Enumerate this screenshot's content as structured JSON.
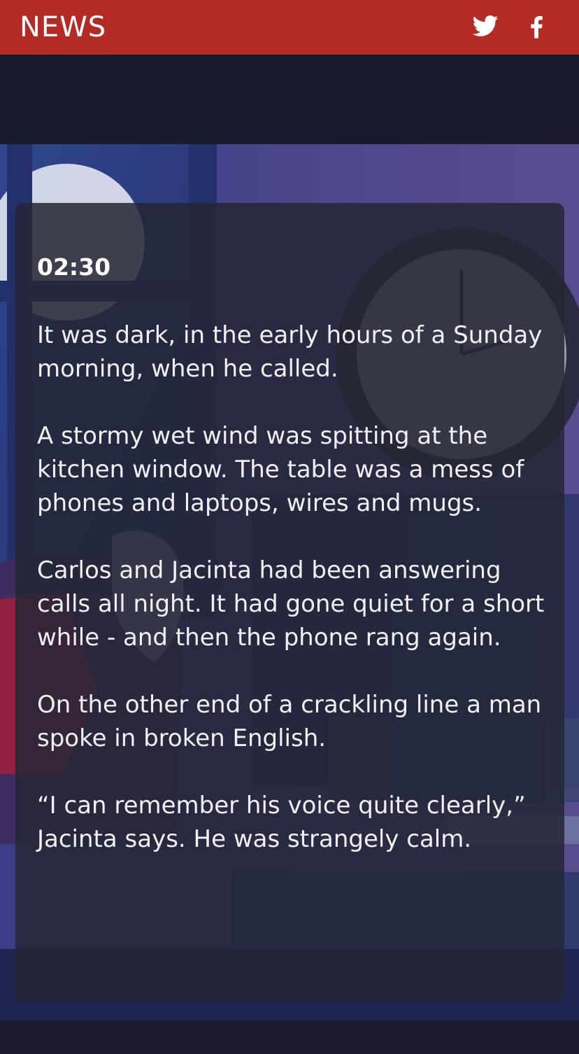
{
  "header": {
    "brand": "NEWS",
    "share_icons": [
      "twitter-icon",
      "facebook-icon"
    ],
    "background_color": "#b32b24"
  },
  "story": {
    "time": "02:30",
    "paragraphs": [
      "It was dark, in the early hours of a Sunday morning, when he called.",
      "A stormy wet wind was spitting at the kitchen window. The table was a mess of phones and laptops, wires and mugs.",
      "Carlos and Jacinta had been answering calls all night. It had gone quiet for a short while - and then the phone rang again.",
      "On the other end of a crackling line a man spoke in broken English.",
      "“I can remember his voice quite clearly,” Jacinta says. He was strangely calm."
    ]
  }
}
